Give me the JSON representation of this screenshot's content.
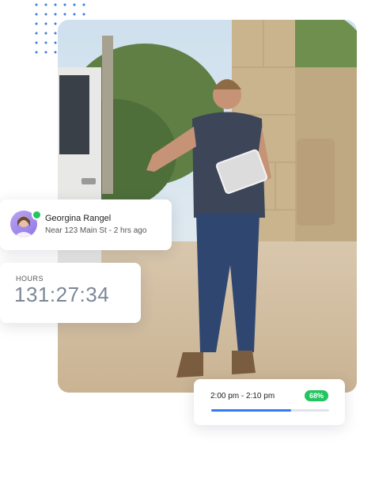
{
  "user_card": {
    "name": "Georgina Rangel",
    "location_time": "Near 123 Main St - 2 hrs ago",
    "status": "online"
  },
  "hours_card": {
    "label": "HOURS",
    "value": "131:27:34"
  },
  "time_card": {
    "range": "2:00 pm - 2:10 pm",
    "progress_label": "68%",
    "progress": 0.68
  },
  "colors": {
    "accent_blue": "#2f7cf6",
    "success_green": "#22c55e",
    "dots_blue": "#3d7be0"
  }
}
